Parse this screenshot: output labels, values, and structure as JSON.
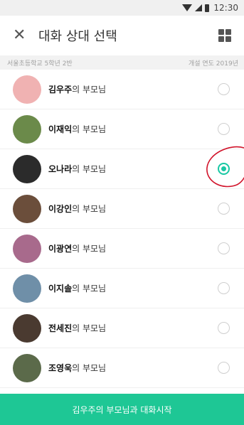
{
  "status_bar": {
    "time": "12:30"
  },
  "header": {
    "close_icon": "close-icon",
    "title": "대화 상대 선택",
    "menu_icon": "grid-icon"
  },
  "subbar": {
    "class_name": "서울초등학교 5학년 2반",
    "year_label": "개설 연도 2019년"
  },
  "contacts": [
    {
      "name": "김우주",
      "suffix": "의 부모님",
      "avatar_color": "#f0b2b2",
      "selected": false
    },
    {
      "name": "이재익",
      "suffix": "의 부모님",
      "avatar_color": "#6b8a4a",
      "selected": false
    },
    {
      "name": "오나라",
      "suffix": "의 부모님",
      "avatar_color": "#2b2b2b",
      "selected": true
    },
    {
      "name": "이강인",
      "suffix": "의 부모님",
      "avatar_color": "#6b4e3b",
      "selected": false
    },
    {
      "name": "이광연",
      "suffix": "의 부모님",
      "avatar_color": "#a86a8c",
      "selected": false
    },
    {
      "name": "이지솔",
      "suffix": "의 부모님",
      "avatar_color": "#6f8fa8",
      "selected": false
    },
    {
      "name": "전세진",
      "suffix": "의 부모님",
      "avatar_color": "#4a3a30",
      "selected": false
    },
    {
      "name": "조영욱",
      "suffix": "의 부모님",
      "avatar_color": "#5b6a4a",
      "selected": false
    }
  ],
  "cta": {
    "label": "김우주의 부모님과 대화시작"
  },
  "colors": {
    "accent": "#1ec795",
    "radio_selected": "#19c8a4",
    "annotation": "#d1132a"
  }
}
